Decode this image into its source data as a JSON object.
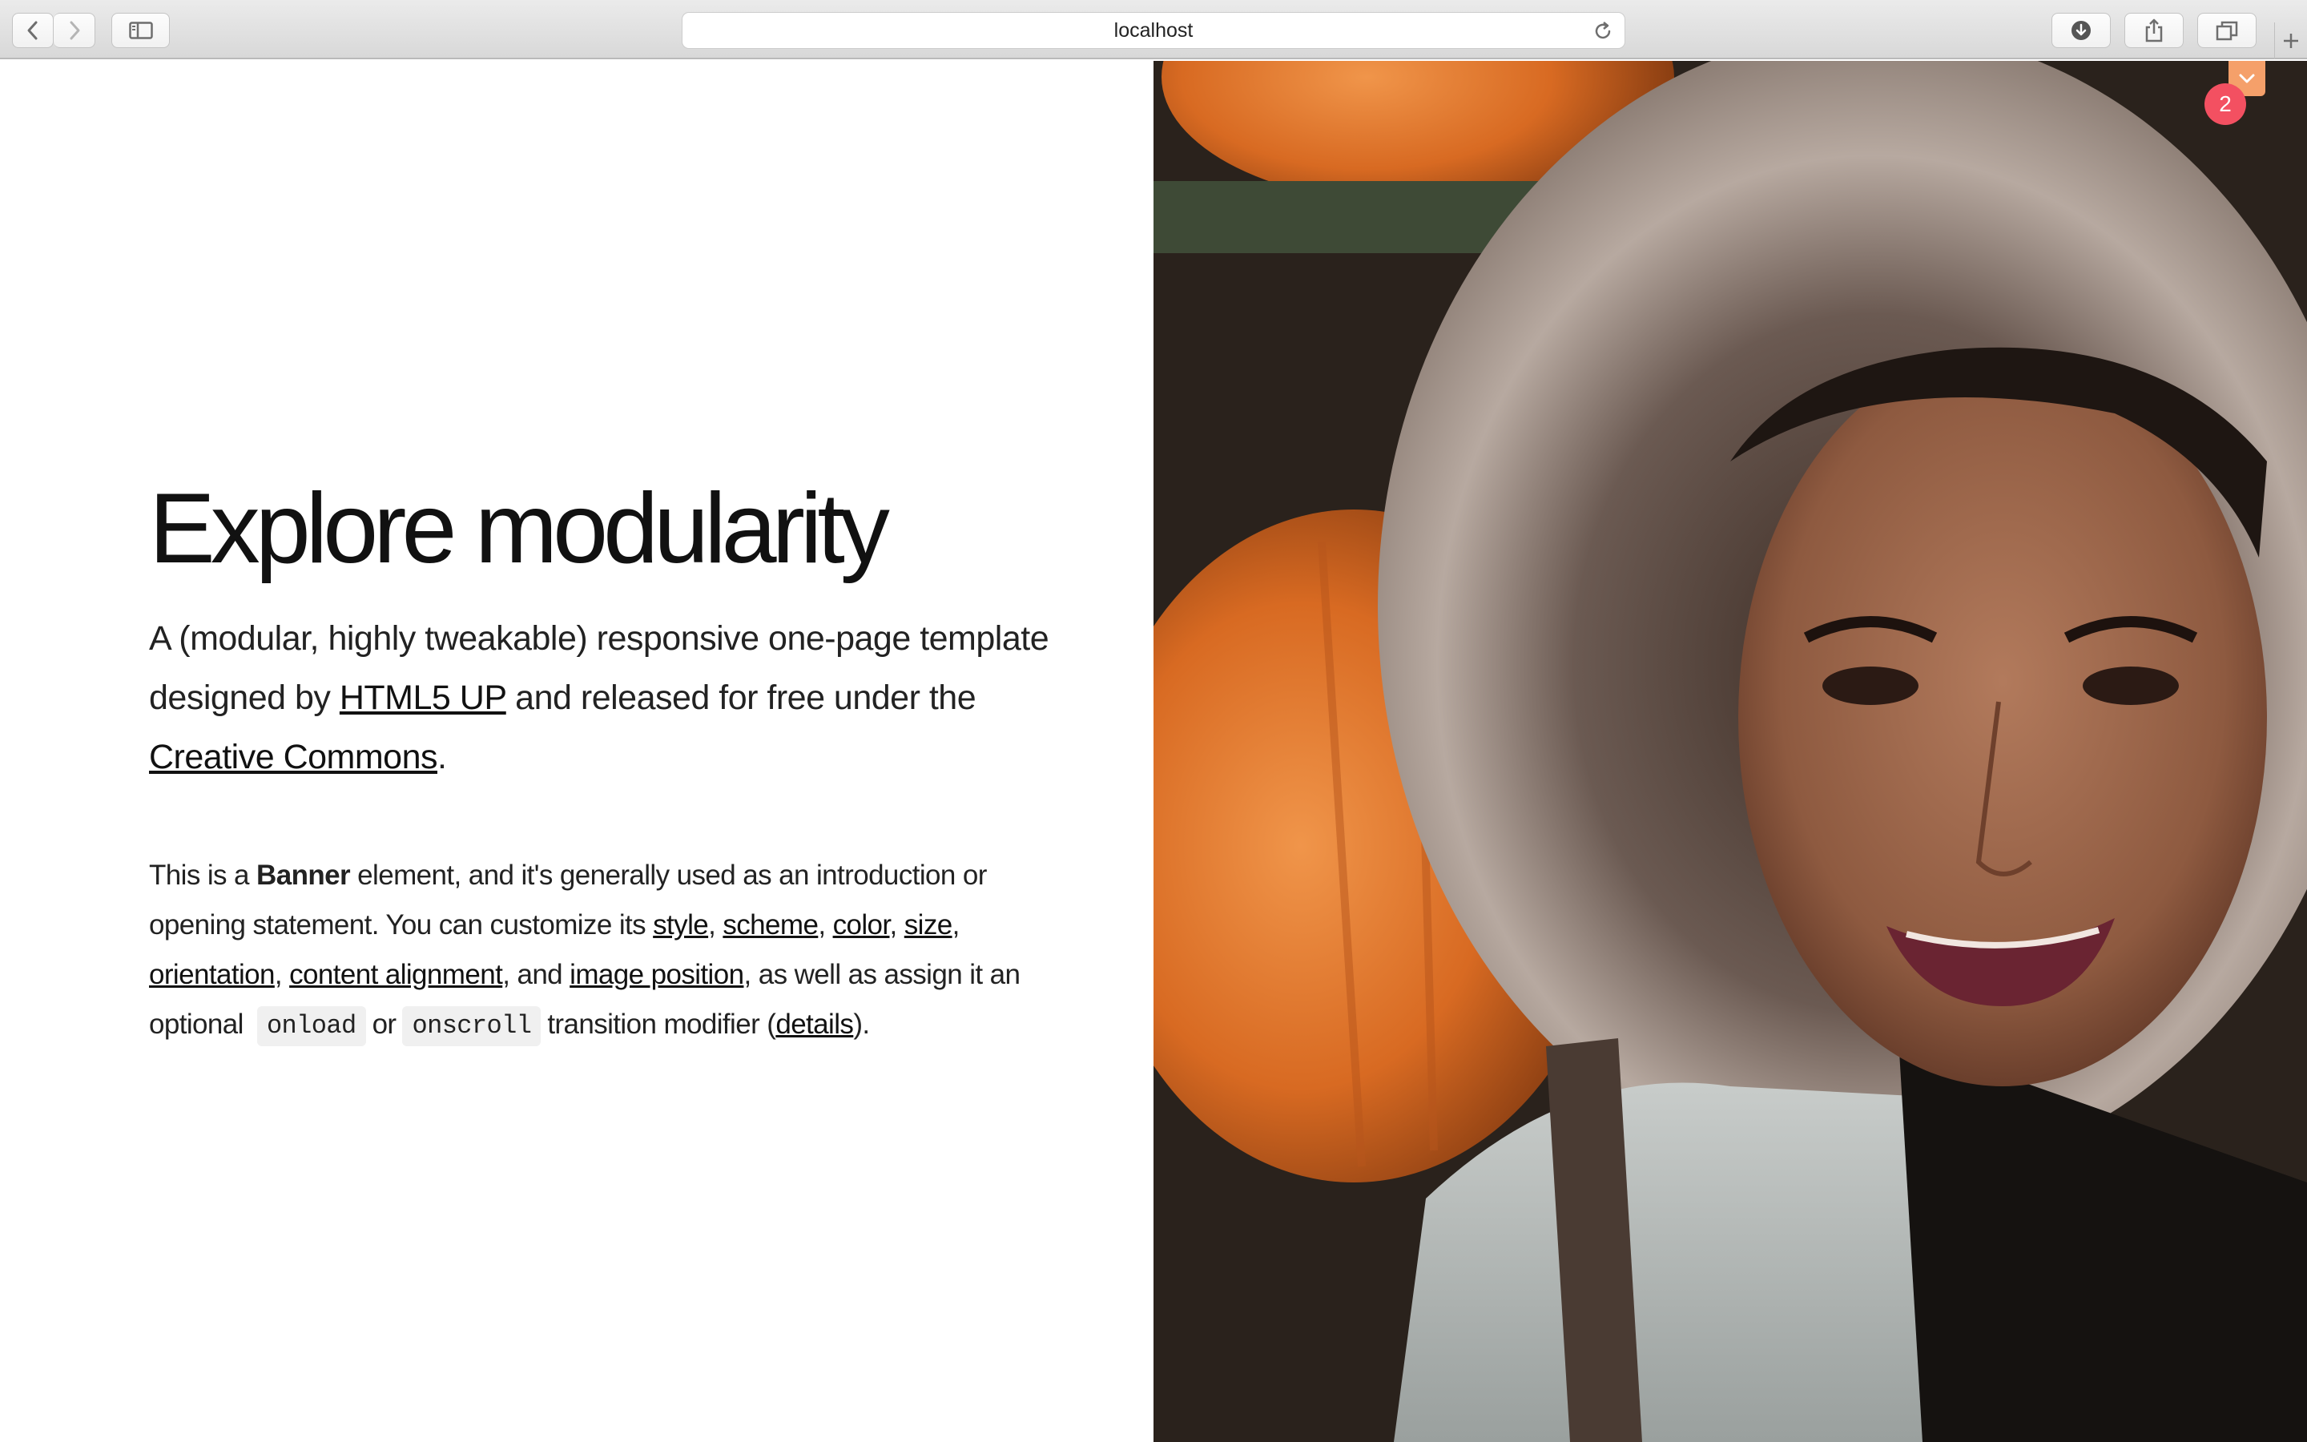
{
  "browser": {
    "url": "localhost",
    "icons": {
      "back": "chevron-left-icon",
      "forward": "chevron-right-icon",
      "sidebar": "sidebar-icon",
      "reload": "reload-icon",
      "downloads": "download-icon",
      "share": "share-icon",
      "tabs": "tabs-overview-icon",
      "new_tab": "plus-icon"
    }
  },
  "banner": {
    "title": "Explore modularity",
    "lead": {
      "part1": "A (modular, highly tweakable) responsive one-page template designed by ",
      "link1": "HTML5 UP",
      "part2": " and released for free under the ",
      "link2": "Creative Commons",
      "part3": "."
    },
    "body": {
      "t1": "This is a ",
      "bold": "Banner",
      "t2": " element, and it's generally used as an introduction or opening statement. You can customize its ",
      "link_style": "style",
      "sep1": ", ",
      "link_scheme": "scheme",
      "sep2": ", ",
      "link_color": "color",
      "sep3": ", ",
      "link_size": "size",
      "sep4": ", ",
      "link_orientation": "orientation",
      "sep5": ", ",
      "link_alignment": "content alignment",
      "t3": ", and ",
      "link_image_position": "image position",
      "t4": ", as well as assign it an optional ",
      "code1": "onload",
      "t5": "or",
      "code2": "onscroll",
      "t6": "transition modifier (",
      "link_details": "details",
      "t7": ")."
    }
  },
  "widgets": {
    "scroll_icon": "chevron-down-icon",
    "badge_count": "2",
    "scroll_color": "#f5a06a",
    "badge_color": "#f35061"
  }
}
